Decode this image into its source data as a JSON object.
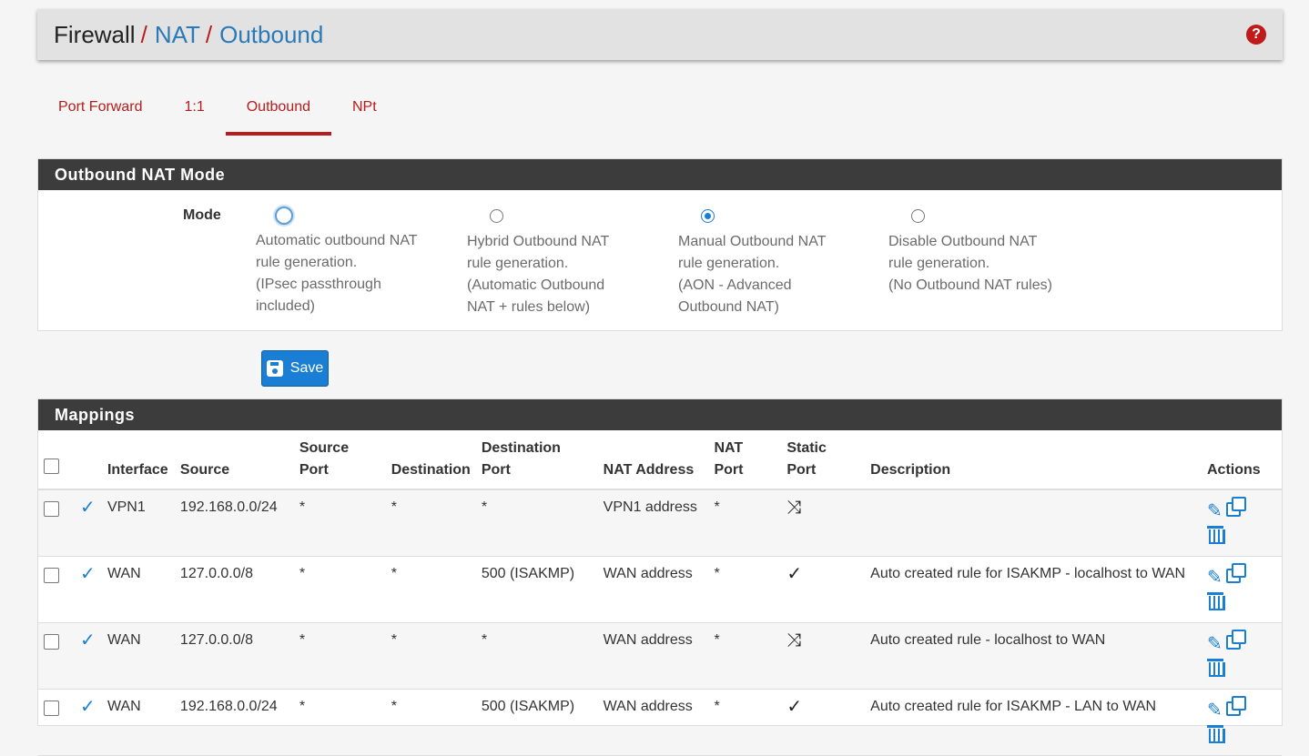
{
  "breadcrumb": {
    "root": "Firewall",
    "sep": "/",
    "nat": "NAT",
    "current": "Outbound"
  },
  "help": {
    "label": "?"
  },
  "tabs": [
    {
      "label": "Port Forward",
      "active": false
    },
    {
      "label": "1:1",
      "active": false
    },
    {
      "label": "Outbound",
      "active": true
    },
    {
      "label": "NPt",
      "active": false
    }
  ],
  "mode_panel": {
    "title": "Outbound NAT Mode",
    "label": "Mode",
    "options": [
      {
        "lines": [
          "Automatic outbound NAT",
          "rule generation.",
          "(IPsec passthrough",
          "included)"
        ],
        "checked": false
      },
      {
        "lines": [
          "Hybrid Outbound NAT",
          "rule generation.",
          "(Automatic Outbound",
          "NAT + rules below)"
        ],
        "checked": false
      },
      {
        "lines": [
          "Manual Outbound NAT",
          "rule generation.",
          "(AON - Advanced",
          "Outbound NAT)"
        ],
        "checked": true
      },
      {
        "lines": [
          "Disable Outbound NAT",
          "rule generation.",
          "(No Outbound NAT rules)"
        ],
        "checked": false
      }
    ]
  },
  "save_button": {
    "label": "Save"
  },
  "mappings": {
    "title": "Mappings",
    "headers": {
      "interface": "Interface",
      "source": "Source",
      "source_port": "Source Port",
      "destination": "Destination",
      "destination_port": "Destination Port",
      "nat_address": "NAT Address",
      "nat_port": "NAT Port",
      "static_port": "Static Port",
      "description": "Description",
      "actions": "Actions"
    },
    "rows": [
      {
        "interface": "VPN1",
        "source": "192.168.0.0/24",
        "source_port": "*",
        "destination": "*",
        "destination_port": "*",
        "nat_address": "VPN1 address",
        "nat_port": "*",
        "static_port": "shuffle",
        "description": ""
      },
      {
        "interface": "WAN",
        "source": "127.0.0.0/8",
        "source_port": "*",
        "destination": "*",
        "destination_port": "500 (ISAKMP)",
        "nat_address": "WAN address",
        "nat_port": "*",
        "static_port": "check",
        "description": "Auto created rule for ISAKMP - localhost to WAN"
      },
      {
        "interface": "WAN",
        "source": "127.0.0.0/8",
        "source_port": "*",
        "destination": "*",
        "destination_port": "*",
        "nat_address": "WAN address",
        "nat_port": "*",
        "static_port": "shuffle",
        "description": "Auto created rule - localhost to WAN"
      },
      {
        "interface": "WAN",
        "source": "192.168.0.0/24",
        "source_port": "*",
        "destination": "*",
        "destination_port": "500 (ISAKMP)",
        "nat_address": "WAN address",
        "nat_port": "*",
        "static_port": "check",
        "description": "Auto created rule for ISAKMP - LAN to WAN"
      }
    ]
  },
  "colors": {
    "accent_red": "#b71c1c",
    "link_blue": "#2a7ab8",
    "button_blue": "#1a7fd4",
    "panel_header": "#3c3c3c"
  }
}
